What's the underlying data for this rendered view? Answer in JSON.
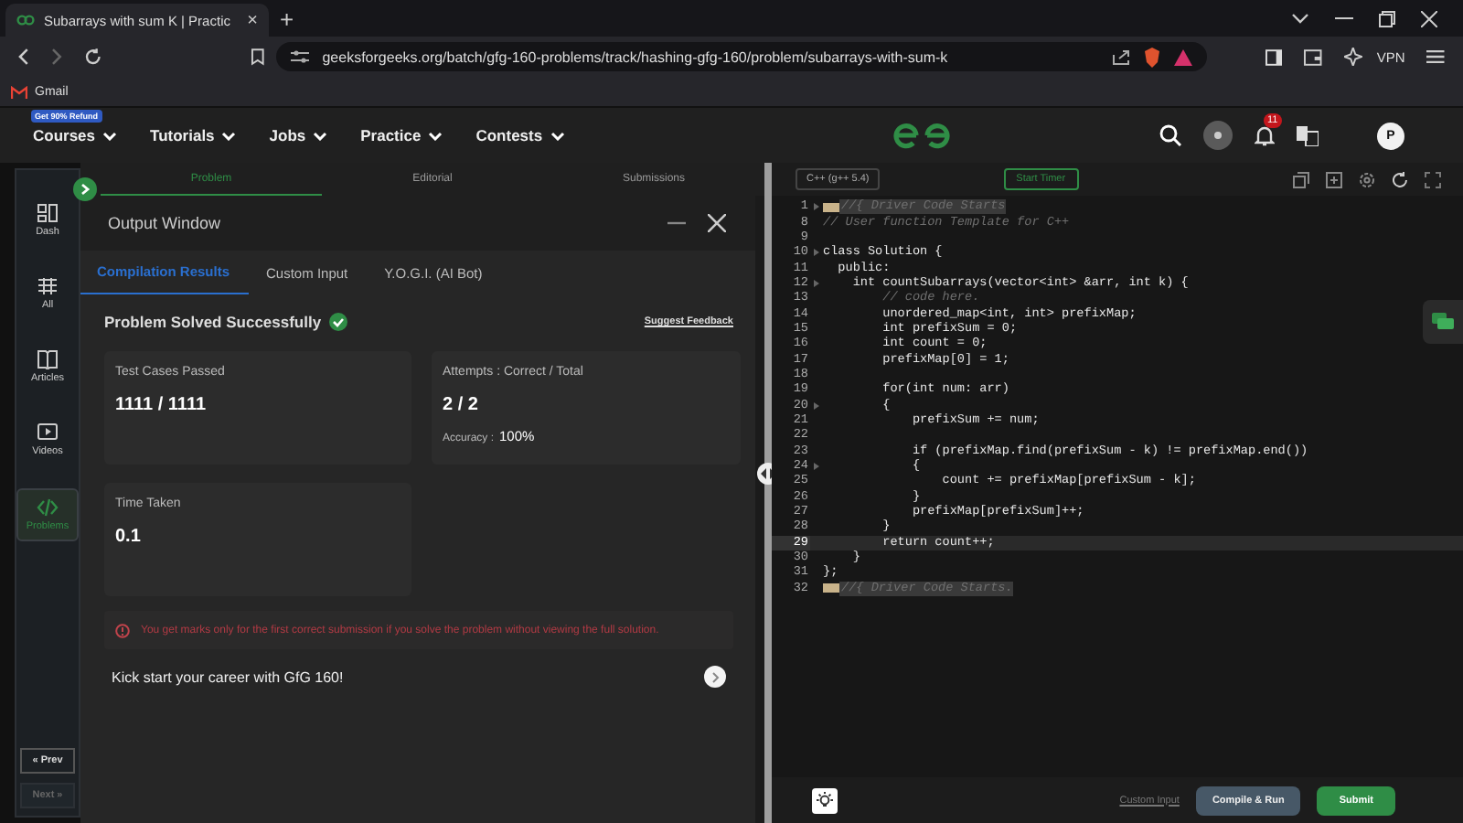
{
  "browser": {
    "tab": {
      "title": "Subarrays with sum K | Practic",
      "close": "×"
    },
    "new_tab": "+",
    "url": "geeksforgeeks.org/batch/gfg-160-problems/track/hashing-gfg-160/problem/subarrays-with-sum-k",
    "vpn": "VPN",
    "bookmarks": [
      "Gmail"
    ]
  },
  "nav": {
    "items": [
      {
        "label": "Courses",
        "badge": "Get 90% Refund"
      },
      {
        "label": "Tutorials"
      },
      {
        "label": "Jobs"
      },
      {
        "label": "Practice"
      },
      {
        "label": "Contests"
      }
    ],
    "notifications": "11",
    "avatar": "P"
  },
  "sidebar": {
    "items": [
      {
        "label": "Dash",
        "selected": false
      },
      {
        "label": "All",
        "selected": false
      },
      {
        "label": "Articles",
        "selected": false
      },
      {
        "label": "Videos",
        "selected": false
      },
      {
        "label": "Problems",
        "selected": true
      }
    ],
    "buttons": [
      {
        "label": "« Prev",
        "disabled": false
      },
      {
        "label": "Next »",
        "disabled": true
      }
    ]
  },
  "problem_tabs": [
    {
      "label": "Problem",
      "selected": true
    },
    {
      "label": "Editorial",
      "selected": false
    },
    {
      "label": "Submissions",
      "selected": false
    }
  ],
  "output": {
    "title": "Output Window",
    "tabs": [
      {
        "label": "Compilation Results",
        "selected": true
      },
      {
        "label": "Custom Input",
        "selected": false
      },
      {
        "label": "Y.O.G.I. (AI Bot)",
        "selected": false
      }
    ],
    "status": "Problem Solved Successfully",
    "feedback": "Suggest Feedback",
    "cards": [
      {
        "label": "Test Cases Passed",
        "value": "1111 / 1111"
      },
      {
        "label": "Attempts : Correct / Total",
        "value": "2 / 2",
        "note_label": "Accuracy :",
        "note_value": "100%"
      },
      {
        "label": "Time Taken",
        "value": "0.1"
      }
    ],
    "warning": "You get marks only for the first correct submission if you solve the problem without viewing the full solution.",
    "promo": "Kick start your career with GfG 160!"
  },
  "editor": {
    "language": "C++ (g++ 5.4)",
    "timer": "Start Timer",
    "custom_input": "Custom Input",
    "compile": "Compile & Run",
    "submit": "Submit",
    "lines": [
      {
        "num": "1",
        "kind": "comment",
        "fold": true,
        "folded": true,
        "current": false,
        "text": "//{ Driver Code Starts"
      },
      {
        "num": "8",
        "kind": "comment",
        "fold": false,
        "folded": false,
        "current": false,
        "text": "// User function Template for C++"
      },
      {
        "num": "9",
        "fold": false,
        "folded": false,
        "current": false
      },
      {
        "num": "10",
        "kind": "code",
        "fold": true,
        "folded": false,
        "current": false,
        "text": "class Solution {"
      },
      {
        "num": "11",
        "kind": "code",
        "fold": false,
        "folded": false,
        "current": false,
        "text": "  public:"
      },
      {
        "num": "12",
        "kind": "code",
        "fold": true,
        "folded": false,
        "current": false,
        "text": "    int countSubarrays(vector<int> &arr, int k) {"
      },
      {
        "num": "13",
        "kind": "comment",
        "fold": false,
        "folded": false,
        "current": false,
        "text": "        // code here."
      },
      {
        "num": "14",
        "kind": "code",
        "fold": false,
        "folded": false,
        "current": false,
        "text": "        unordered_map<int, int> prefixMap;"
      },
      {
        "num": "15",
        "kind": "code",
        "fold": false,
        "folded": false,
        "current": false,
        "text": "        int prefixSum = 0;"
      },
      {
        "num": "16",
        "kind": "code",
        "fold": false,
        "folded": false,
        "current": false,
        "text": "        int count = 0;"
      },
      {
        "num": "17",
        "kind": "code",
        "fold": false,
        "folded": false,
        "current": false,
        "text": "        prefixMap[0] = 1;"
      },
      {
        "num": "18",
        "fold": false,
        "folded": false,
        "current": false
      },
      {
        "num": "19",
        "kind": "code",
        "fold": false,
        "folded": false,
        "current": false,
        "text": "        for(int num: arr)"
      },
      {
        "num": "20",
        "kind": "code",
        "fold": true,
        "folded": false,
        "current": false,
        "text": "        {"
      },
      {
        "num": "21",
        "kind": "code",
        "fold": false,
        "folded": false,
        "current": false,
        "text": "            prefixSum += num;"
      },
      {
        "num": "22",
        "fold": false,
        "folded": false,
        "current": false
      },
      {
        "num": "23",
        "kind": "code",
        "fold": false,
        "folded": false,
        "current": false,
        "text": "            if (prefixMap.find(prefixSum - k) != prefixMap.end())"
      },
      {
        "num": "24",
        "kind": "code",
        "fold": true,
        "folded": false,
        "current": false,
        "text": "            {"
      },
      {
        "num": "25",
        "kind": "code",
        "fold": false,
        "folded": false,
        "current": false,
        "text": "                count += prefixMap[prefixSum - k];"
      },
      {
        "num": "26",
        "kind": "code",
        "fold": false,
        "folded": false,
        "current": false,
        "text": "            }"
      },
      {
        "num": "27",
        "kind": "code",
        "fold": false,
        "folded": false,
        "current": false,
        "text": "            prefixMap[prefixSum]++;"
      },
      {
        "num": "28",
        "kind": "code",
        "fold": false,
        "folded": false,
        "current": false,
        "text": "        }"
      },
      {
        "num": "29",
        "kind": "code",
        "fold": false,
        "folded": false,
        "current": true,
        "text": "        return count++;"
      },
      {
        "num": "30",
        "kind": "code",
        "fold": false,
        "folded": false,
        "current": false,
        "text": "    }"
      },
      {
        "num": "31",
        "kind": "code",
        "fold": false,
        "folded": false,
        "current": false,
        "text": "};"
      },
      {
        "num": "32",
        "kind": "comment",
        "fold": false,
        "folded": true,
        "current": false,
        "text": "//{ Driver Code Starts."
      }
    ]
  }
}
